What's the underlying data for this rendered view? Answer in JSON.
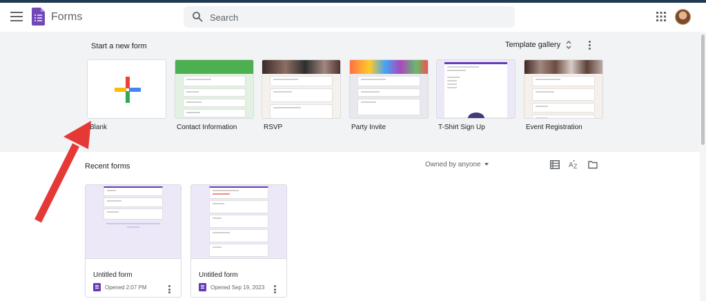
{
  "header": {
    "app_title": "Forms",
    "search_placeholder": "Search"
  },
  "templates": {
    "section_title": "Start a new form",
    "gallery_label": "Template gallery",
    "items": [
      {
        "label": "Blank"
      },
      {
        "label": "Contact Information"
      },
      {
        "label": "RSVP"
      },
      {
        "label": "Party Invite"
      },
      {
        "label": "T-Shirt Sign Up"
      },
      {
        "label": "Event Registration"
      }
    ]
  },
  "recent": {
    "section_title": "Recent forms",
    "owner_filter": "Owned by anyone",
    "forms": [
      {
        "name": "Untitled form",
        "opened": "Opened 2:07 PM"
      },
      {
        "name": "Untitled form",
        "opened": "Opened Sep 19, 2023"
      }
    ]
  },
  "colors": {
    "accent": "#673ab7",
    "band": "#f1f3f4",
    "annotation_arrow": "#e53935"
  }
}
